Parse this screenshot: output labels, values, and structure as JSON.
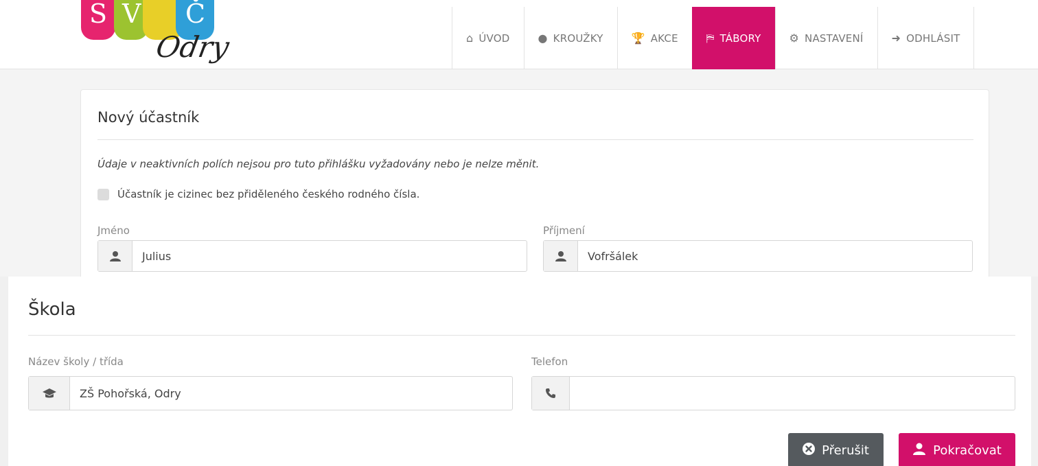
{
  "logo": {
    "letters": [
      "S",
      "V",
      "Č"
    ],
    "script": "Odry"
  },
  "nav": [
    {
      "label": "ÚVOD",
      "icon": "home-icon",
      "glyph": "⌂"
    },
    {
      "label": "KROUŽKY",
      "icon": "lightbulb-icon",
      "glyph": "●"
    },
    {
      "label": "AKCE",
      "icon": "trophy-icon",
      "glyph": "🏆"
    },
    {
      "label": "TÁBORY",
      "icon": "signpost-icon",
      "glyph": "⛿"
    },
    {
      "label": "NASTAVENÍ",
      "icon": "gear-icon",
      "glyph": "⚙"
    },
    {
      "label": "ODHLÁSIT",
      "icon": "logout-icon",
      "glyph": "➜"
    }
  ],
  "nav_active_index": 3,
  "participant": {
    "title": "Nový účastník",
    "note": "Údaje v neaktivních polích nejsou pro tuto přihlášku vyžadovány nebo je nelze měnit.",
    "foreign_checkbox_label": "Účastník je cizinec bez přiděleného českého rodného čísla.",
    "first_name_label": "Jméno",
    "first_name_value": "Julius",
    "last_name_label": "Příjmení",
    "last_name_value": "Vofršálek"
  },
  "school": {
    "title": "Škola",
    "name_label": "Název školy / třída",
    "name_value": "ZŠ Pohořská, Odry",
    "phone_label": "Telefon",
    "phone_value": ""
  },
  "actions": {
    "cancel_label": "Přerušit",
    "continue_label": "Pokračovat"
  },
  "colors": {
    "accent": "#d2106a",
    "cancel": "#555a5e"
  }
}
